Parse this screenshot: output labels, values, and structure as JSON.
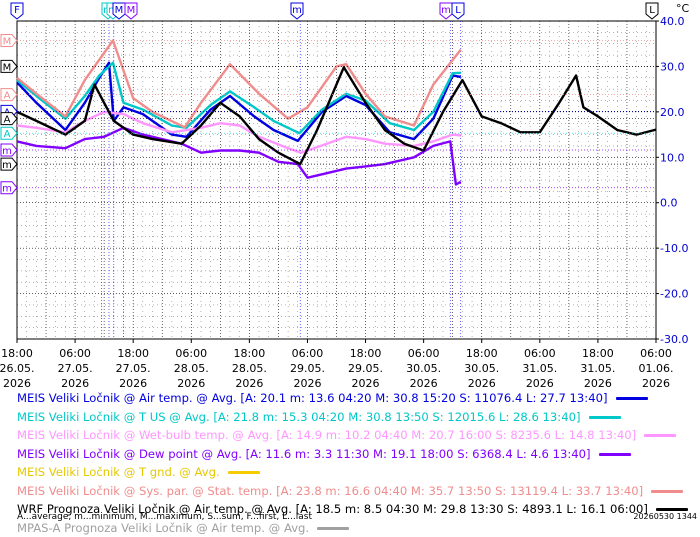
{
  "chart_data": {
    "type": "line",
    "y_unit": "°C",
    "ylim": [
      -30,
      40
    ],
    "y_ticks": [
      "40.0",
      "30.0",
      "20.0",
      "10.0",
      "0.0",
      "-10.0",
      "-20.0",
      "-30.0"
    ],
    "x_ticks": [
      {
        "time": "18:00",
        "date": "26.05.",
        "year": "2026"
      },
      {
        "time": "06:00",
        "date": "27.05.",
        "year": "2026"
      },
      {
        "time": "18:00",
        "date": "27.05.",
        "year": "2026"
      },
      {
        "time": "06:00",
        "date": "28.05.",
        "year": "2026"
      },
      {
        "time": "18:00",
        "date": "28.05.",
        "year": "2026"
      },
      {
        "time": "06:00",
        "date": "29.05.",
        "year": "2026"
      },
      {
        "time": "18:00",
        "date": "29.05.",
        "year": "2026"
      },
      {
        "time": "06:00",
        "date": "30.05.",
        "year": "2026"
      },
      {
        "time": "18:00",
        "date": "30.05.",
        "year": "2026"
      },
      {
        "time": "06:00",
        "date": "31.05.",
        "year": "2026"
      },
      {
        "time": "18:00",
        "date": "31.05.",
        "year": "2026"
      },
      {
        "time": "06:00",
        "date": "01.06.",
        "year": "2026"
      }
    ],
    "grid": true,
    "series": [
      {
        "name": "MEIS Veliki Ločnik @ Air temp. @ Avg.",
        "color": "#0000e0",
        "x": [
          "26.05. 18:00",
          "26.05. 22:00",
          "27.05. 04:00",
          "27.05. 08:00",
          "27.05. 11:00",
          "27.05. 13:00",
          "27.05. 14:00",
          "27.05. 16:00",
          "27.05. 20:00",
          "28.05. 02:00",
          "28.05. 05:00",
          "28.05. 10:00",
          "28.05. 14:00",
          "28.05. 19:00",
          "28.05. 23:00",
          "29.05. 04:00",
          "29.05. 09:00",
          "29.05. 14:00",
          "29.05. 18:00",
          "29.05. 23:00",
          "30.05. 04:00",
          "30.05. 08:00",
          "30.05. 12:00",
          "30.05. 13:40"
        ],
        "y": [
          26.5,
          22.0,
          16.0,
          22.0,
          27.5,
          30.8,
          18.0,
          21.0,
          19.5,
          15.0,
          14.5,
          20.5,
          23.5,
          19.0,
          16.0,
          13.6,
          20.0,
          23.5,
          21.5,
          15.5,
          14.0,
          18.5,
          28.0,
          27.7
        ]
      },
      {
        "name": "MEIS Veliki Ločnik @ T US @ Avg.",
        "color": "#00c8c8",
        "x": [
          "26.05. 18:00",
          "26.05. 22:00",
          "27.05. 04:00",
          "27.05. 08:00",
          "27.05. 11:00",
          "27.05. 13:50",
          "27.05. 16:00",
          "27.05. 20:00",
          "28.05. 02:00",
          "28.05. 05:00",
          "28.05. 10:00",
          "28.05. 14:00",
          "28.05. 19:00",
          "28.05. 23:00",
          "29.05. 04:20",
          "29.05. 09:00",
          "29.05. 14:00",
          "29.05. 18:00",
          "29.05. 23:00",
          "30.05. 04:00",
          "30.05. 08:00",
          "30.05. 12:00",
          "30.05. 13:40"
        ],
        "y": [
          27.0,
          23.5,
          18.5,
          23.5,
          28.0,
          30.8,
          22.0,
          20.5,
          17.0,
          16.5,
          21.5,
          24.5,
          21.0,
          18.0,
          15.3,
          20.5,
          24.0,
          22.5,
          17.5,
          16.0,
          20.0,
          28.5,
          28.6
        ]
      },
      {
        "name": "MEIS Veliki Ločnik @ Wet-bulb temp. @ Avg.",
        "color": "#ff96ff",
        "x": [
          "26.05. 18:00",
          "26.05. 22:00",
          "27.05. 04:00",
          "27.05. 08:00",
          "27.05. 12:00",
          "27.05. 16:00",
          "27.05. 20:00",
          "28.05. 02:00",
          "28.05. 08:00",
          "28.05. 12:00",
          "28.05. 16:00",
          "28.05. 20:00",
          "29.05. 02:00",
          "29.05. 04:40",
          "29.05. 10:00",
          "29.05. 14:00",
          "29.05. 18:00",
          "29.05. 22:00",
          "30.05. 04:00",
          "30.05. 08:00",
          "30.05. 12:00",
          "30.05. 13:40"
        ],
        "y": [
          17.0,
          16.5,
          15.5,
          18.0,
          20.0,
          19.5,
          17.5,
          15.5,
          16.5,
          17.5,
          17.0,
          14.5,
          12.0,
          11.0,
          13.0,
          14.5,
          14.0,
          13.0,
          12.5,
          13.5,
          15.0,
          14.8
        ]
      },
      {
        "name": "MEIS Veliki Ločnik @ Dew point @ Avg.",
        "color": "#8200ff",
        "x": [
          "26.05. 18:00",
          "26.05. 22:00",
          "27.05. 04:00",
          "27.05. 08:00",
          "27.05. 12:00",
          "27.05. 16:00",
          "27.05. 20:00",
          "28.05. 02:00",
          "28.05. 04:00",
          "28.05. 08:00",
          "28.05. 12:00",
          "28.05. 16:00",
          "28.05. 20:00",
          "29.05. 00:00",
          "29.05. 04:00",
          "29.05. 06:00",
          "29.05. 10:00",
          "29.05. 14:00",
          "29.05. 18:00",
          "29.05. 22:00",
          "30.05. 04:00",
          "30.05. 08:00",
          "30.05. 11:30",
          "30.05. 12:40",
          "30.05. 13:40"
        ],
        "y": [
          13.5,
          12.5,
          12.0,
          14.0,
          14.5,
          16.5,
          15.0,
          13.5,
          13.0,
          11.0,
          11.5,
          11.5,
          11.0,
          9.0,
          8.5,
          5.5,
          6.5,
          7.5,
          8.0,
          8.5,
          10.0,
          12.5,
          13.5,
          4.0,
          4.6
        ]
      },
      {
        "name": "MEIS Veliki Ločnik @ Sys. par. @ Stat. temp.",
        "color": "#f08c8c",
        "x": [
          "26.05. 18:00",
          "26.05. 22:00",
          "27.05. 04:00",
          "27.05. 08:00",
          "27.05. 13:50",
          "27.05. 18:00",
          "27.05. 22:00",
          "28.05. 04:40",
          "28.05. 08:00",
          "28.05. 14:00",
          "28.05. 20:00",
          "29.05. 02:00",
          "29.05. 06:00",
          "29.05. 12:00",
          "29.05. 14:00",
          "29.05. 18:00",
          "29.05. 22:00",
          "30.05. 04:00",
          "30.05. 08:00",
          "30.05. 13:40"
        ],
        "y": [
          27.5,
          24.0,
          19.0,
          27.0,
          35.7,
          23.0,
          20.0,
          16.6,
          22.0,
          30.5,
          24.0,
          18.5,
          21.0,
          30.0,
          30.5,
          24.0,
          19.0,
          17.0,
          26.0,
          33.7
        ]
      },
      {
        "name": "WRF Prognoza Veliki Ločnik @ Air temp. @ Avg.",
        "color": "#000000",
        "x": [
          "26.05. 18:00",
          "26.05. 22:00",
          "27.05. 04:00",
          "27.05. 08:00",
          "27.05. 10:00",
          "27.05. 12:00",
          "27.05. 14:00",
          "27.05. 18:00",
          "27.05. 22:00",
          "28.05. 04:00",
          "28.05. 08:00",
          "28.05. 12:00",
          "28.05. 16:00",
          "28.05. 20:00",
          "29.05. 00:00",
          "29.05. 04:30",
          "29.05. 08:00",
          "29.05. 13:30",
          "29.05. 18:00",
          "29.05. 22:00",
          "30.05. 02:00",
          "30.05. 06:00",
          "30.05. 10:00",
          "30.05. 14:00",
          "30.05. 18:00",
          "30.05. 22:00",
          "31.05. 02:00",
          "31.05. 06:00",
          "31.05. 10:00",
          "31.05. 13:30",
          "31.05. 15:00",
          "31.05. 18:00",
          "31.05. 22:00",
          "01.06. 02:00",
          "01.06. 06:00"
        ],
        "y": [
          20.0,
          18.0,
          15.0,
          18.0,
          26.0,
          22.0,
          18.0,
          15.0,
          14.0,
          13.0,
          17.0,
          22.0,
          19.0,
          14.0,
          11.0,
          8.5,
          16.0,
          29.8,
          22.0,
          16.0,
          13.0,
          11.5,
          20.0,
          27.0,
          19.0,
          17.5,
          15.5,
          15.5,
          22.0,
          28.0,
          21.0,
          19.0,
          16.0,
          15.0,
          16.1
        ]
      }
    ]
  },
  "markers": {
    "top": [
      "F",
      "m",
      "m",
      "M",
      "M",
      "m",
      "m",
      "L",
      "L"
    ],
    "left": [
      "M",
      "M",
      "A",
      "A",
      "A",
      "A",
      "m",
      "m",
      "m"
    ]
  },
  "legend": [
    {
      "text": "MEIS Veliki Ločnik @ Air temp. @ Avg. [A: 20.1 m: 13.6 04:20 M: 30.8 15:20 S: 11076.4 L: 27.7 13:40]",
      "color": "#0000e0",
      "swatch": "#0000e0"
    },
    {
      "text": "MEIS Veliki Ločnik @ T US @ Avg. [A: 21.8 m: 15.3 04:20 M: 30.8 13:50 S: 12015.6 L: 28.6 13:40]",
      "color": "#00c8c8",
      "swatch": "#00c8c8"
    },
    {
      "text": "MEIS Veliki Ločnik @ Wet-bulb temp. @ Avg. [A: 14.9 m: 10.2 04:40 M: 20.7 16:00 S: 8235.6 L: 14.8 13:40]",
      "color": "#ff96ff",
      "swatch": "#ff96ff"
    },
    {
      "text": "MEIS Veliki Ločnik @ Dew point @ Avg. [A: 11.6 m: 3.3 11:30 M: 19.1 18:00 S: 6368.4 L: 4.6 13:40]",
      "color": "#8200ff",
      "swatch": "#8200ff"
    },
    {
      "text": "MEIS Veliki Ločnik @ T gnd. @ Avg.",
      "color": "#e6c800",
      "swatch": "#f5cc00"
    },
    {
      "text": "MEIS Veliki Ločnik @ Sys. par. @ Stat. temp. [A: 23.8 m: 16.6 04:40 M: 35.7 13:50 S: 13119.4 L: 33.7 13:40]",
      "color": "#f08c8c",
      "swatch": "#f08c8c"
    },
    {
      "text": "WRF Prognoza Veliki Ločnik @ Air temp. @ Avg. [A: 18.5 m: 8.5 04:30 M: 29.8 13:30 S: 4893.1 L: 16.1 06:00]",
      "color": "#000000",
      "swatch": "#000000"
    },
    {
      "text": "MPAS-A Prognoza Veliki Ločnik @ Air temp. @ Avg.",
      "color": "#a0a0a0",
      "swatch": "#a0a0a0"
    }
  ],
  "footer": "A...average, m...minimum, M...maximum, S...sum, F...first, L...last",
  "stamp": "20260530 1344"
}
